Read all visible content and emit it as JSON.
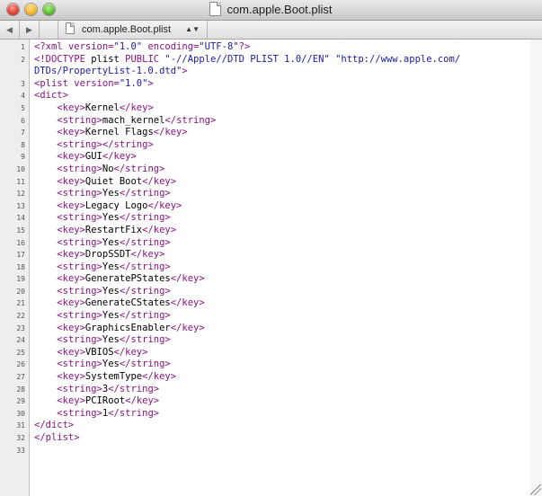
{
  "window": {
    "title": "com.apple.Boot.plist"
  },
  "navbar": {
    "back_glyph": "◀",
    "forward_glyph": "▶",
    "file_name": "com.apple.Boot.plist",
    "popup_arrows": "▲▼"
  },
  "colors": {
    "tag": "#881280",
    "string": "#1a1aa6",
    "text": "#000000"
  },
  "lines": [
    {
      "n": "1",
      "parts": [
        {
          "t": "<?xml ",
          "c": "tag"
        },
        {
          "t": "version=",
          "c": "tag"
        },
        {
          "t": "\"1.0\"",
          "c": "str"
        },
        {
          "t": " encoding=",
          "c": "tag"
        },
        {
          "t": "\"UTF-8\"",
          "c": "str"
        },
        {
          "t": "?>",
          "c": "tag"
        }
      ]
    },
    {
      "n": "2",
      "parts": [
        {
          "t": "<!DOCTYPE ",
          "c": "tag"
        },
        {
          "t": "plist ",
          "c": "plain"
        },
        {
          "t": "PUBLIC ",
          "c": "tag"
        },
        {
          "t": "\"-//Apple//DTD PLIST 1.0//EN\"",
          "c": "str"
        },
        {
          "t": " \"http://www.apple.com/",
          "c": "str"
        }
      ]
    },
    {
      "n": "",
      "parts": [
        {
          "t": "DTDs/PropertyList-1.0.dtd\"",
          "c": "str"
        },
        {
          "t": ">",
          "c": "tag"
        }
      ]
    },
    {
      "n": "3",
      "parts": [
        {
          "t": "<plist ",
          "c": "tag"
        },
        {
          "t": "version=",
          "c": "tag"
        },
        {
          "t": "\"1.0\"",
          "c": "str"
        },
        {
          "t": ">",
          "c": "tag"
        }
      ]
    },
    {
      "n": "4",
      "parts": [
        {
          "t": "<dict>",
          "c": "tag"
        }
      ]
    },
    {
      "n": "5",
      "parts": [
        {
          "t": "    ",
          "c": "plain"
        },
        {
          "t": "<key>",
          "c": "tag"
        },
        {
          "t": "Kernel",
          "c": "plain"
        },
        {
          "t": "</key>",
          "c": "tag"
        }
      ]
    },
    {
      "n": "6",
      "parts": [
        {
          "t": "    ",
          "c": "plain"
        },
        {
          "t": "<string>",
          "c": "tag"
        },
        {
          "t": "mach_kernel",
          "c": "plain"
        },
        {
          "t": "</string>",
          "c": "tag"
        }
      ]
    },
    {
      "n": "7",
      "parts": [
        {
          "t": "    ",
          "c": "plain"
        },
        {
          "t": "<key>",
          "c": "tag"
        },
        {
          "t": "Kernel Flags",
          "c": "plain"
        },
        {
          "t": "</key>",
          "c": "tag"
        }
      ]
    },
    {
      "n": "8",
      "parts": [
        {
          "t": "    ",
          "c": "plain"
        },
        {
          "t": "<string>",
          "c": "tag"
        },
        {
          "t": "</string>",
          "c": "tag"
        }
      ]
    },
    {
      "n": "9",
      "parts": [
        {
          "t": "    ",
          "c": "plain"
        },
        {
          "t": "<key>",
          "c": "tag"
        },
        {
          "t": "GUI",
          "c": "plain"
        },
        {
          "t": "</key>",
          "c": "tag"
        }
      ]
    },
    {
      "n": "10",
      "parts": [
        {
          "t": "    ",
          "c": "plain"
        },
        {
          "t": "<string>",
          "c": "tag"
        },
        {
          "t": "No",
          "c": "plain"
        },
        {
          "t": "</string>",
          "c": "tag"
        }
      ]
    },
    {
      "n": "11",
      "parts": [
        {
          "t": "    ",
          "c": "plain"
        },
        {
          "t": "<key>",
          "c": "tag"
        },
        {
          "t": "Quiet Boot",
          "c": "plain"
        },
        {
          "t": "</key>",
          "c": "tag"
        }
      ]
    },
    {
      "n": "12",
      "parts": [
        {
          "t": "    ",
          "c": "plain"
        },
        {
          "t": "<string>",
          "c": "tag"
        },
        {
          "t": "Yes",
          "c": "plain"
        },
        {
          "t": "</string>",
          "c": "tag"
        }
      ]
    },
    {
      "n": "13",
      "parts": [
        {
          "t": "    ",
          "c": "plain"
        },
        {
          "t": "<key>",
          "c": "tag"
        },
        {
          "t": "Legacy Logo",
          "c": "plain"
        },
        {
          "t": "</key>",
          "c": "tag"
        }
      ]
    },
    {
      "n": "14",
      "parts": [
        {
          "t": "    ",
          "c": "plain"
        },
        {
          "t": "<string>",
          "c": "tag"
        },
        {
          "t": "Yes",
          "c": "plain"
        },
        {
          "t": "</string>",
          "c": "tag"
        }
      ]
    },
    {
      "n": "15",
      "parts": [
        {
          "t": "    ",
          "c": "plain"
        },
        {
          "t": "<key>",
          "c": "tag"
        },
        {
          "t": "RestartFix",
          "c": "plain"
        },
        {
          "t": "</key>",
          "c": "tag"
        }
      ]
    },
    {
      "n": "16",
      "parts": [
        {
          "t": "    ",
          "c": "plain"
        },
        {
          "t": "<string>",
          "c": "tag"
        },
        {
          "t": "Yes",
          "c": "plain"
        },
        {
          "t": "</string>",
          "c": "tag"
        }
      ]
    },
    {
      "n": "17",
      "parts": [
        {
          "t": "    ",
          "c": "plain"
        },
        {
          "t": "<key>",
          "c": "tag"
        },
        {
          "t": "DropSSDT",
          "c": "plain"
        },
        {
          "t": "</key>",
          "c": "tag"
        }
      ]
    },
    {
      "n": "18",
      "parts": [
        {
          "t": "    ",
          "c": "plain"
        },
        {
          "t": "<string>",
          "c": "tag"
        },
        {
          "t": "Yes",
          "c": "plain"
        },
        {
          "t": "</string>",
          "c": "tag"
        }
      ]
    },
    {
      "n": "19",
      "parts": [
        {
          "t": "    ",
          "c": "plain"
        },
        {
          "t": "<key>",
          "c": "tag"
        },
        {
          "t": "GeneratePStates",
          "c": "plain"
        },
        {
          "t": "</key>",
          "c": "tag"
        }
      ]
    },
    {
      "n": "20",
      "parts": [
        {
          "t": "    ",
          "c": "plain"
        },
        {
          "t": "<string>",
          "c": "tag"
        },
        {
          "t": "Yes",
          "c": "plain"
        },
        {
          "t": "</string>",
          "c": "tag"
        }
      ]
    },
    {
      "n": "21",
      "parts": [
        {
          "t": "    ",
          "c": "plain"
        },
        {
          "t": "<key>",
          "c": "tag"
        },
        {
          "t": "GenerateCStates",
          "c": "plain"
        },
        {
          "t": "</key>",
          "c": "tag"
        }
      ]
    },
    {
      "n": "22",
      "parts": [
        {
          "t": "    ",
          "c": "plain"
        },
        {
          "t": "<string>",
          "c": "tag"
        },
        {
          "t": "Yes",
          "c": "plain"
        },
        {
          "t": "</string>",
          "c": "tag"
        }
      ]
    },
    {
      "n": "23",
      "parts": [
        {
          "t": "    ",
          "c": "plain"
        },
        {
          "t": "<key>",
          "c": "tag"
        },
        {
          "t": "GraphicsEnabler",
          "c": "plain"
        },
        {
          "t": "</key>",
          "c": "tag"
        }
      ]
    },
    {
      "n": "24",
      "parts": [
        {
          "t": "    ",
          "c": "plain"
        },
        {
          "t": "<string>",
          "c": "tag"
        },
        {
          "t": "Yes",
          "c": "plain"
        },
        {
          "t": "</string>",
          "c": "tag"
        }
      ]
    },
    {
      "n": "25",
      "parts": [
        {
          "t": "    ",
          "c": "plain"
        },
        {
          "t": "<key>",
          "c": "tag"
        },
        {
          "t": "VBIOS",
          "c": "plain"
        },
        {
          "t": "</key>",
          "c": "tag"
        }
      ]
    },
    {
      "n": "26",
      "parts": [
        {
          "t": "    ",
          "c": "plain"
        },
        {
          "t": "<string>",
          "c": "tag"
        },
        {
          "t": "Yes",
          "c": "plain"
        },
        {
          "t": "</string>",
          "c": "tag"
        }
      ]
    },
    {
      "n": "27",
      "parts": [
        {
          "t": "    ",
          "c": "plain"
        },
        {
          "t": "<key>",
          "c": "tag"
        },
        {
          "t": "SystemType",
          "c": "plain"
        },
        {
          "t": "</key>",
          "c": "tag"
        }
      ]
    },
    {
      "n": "28",
      "parts": [
        {
          "t": "    ",
          "c": "plain"
        },
        {
          "t": "<string>",
          "c": "tag"
        },
        {
          "t": "3",
          "c": "plain"
        },
        {
          "t": "</string>",
          "c": "tag"
        }
      ]
    },
    {
      "n": "29",
      "parts": [
        {
          "t": "    ",
          "c": "plain"
        },
        {
          "t": "<key>",
          "c": "tag"
        },
        {
          "t": "PCIRoot",
          "c": "plain"
        },
        {
          "t": "</key>",
          "c": "tag"
        }
      ]
    },
    {
      "n": "30",
      "parts": [
        {
          "t": "    ",
          "c": "plain"
        },
        {
          "t": "<string>",
          "c": "tag"
        },
        {
          "t": "1",
          "c": "plain"
        },
        {
          "t": "</string>",
          "c": "tag"
        }
      ]
    },
    {
      "n": "31",
      "parts": [
        {
          "t": "</dict>",
          "c": "tag"
        }
      ]
    },
    {
      "n": "32",
      "parts": [
        {
          "t": "</plist>",
          "c": "tag"
        }
      ]
    },
    {
      "n": "33",
      "parts": []
    }
  ]
}
